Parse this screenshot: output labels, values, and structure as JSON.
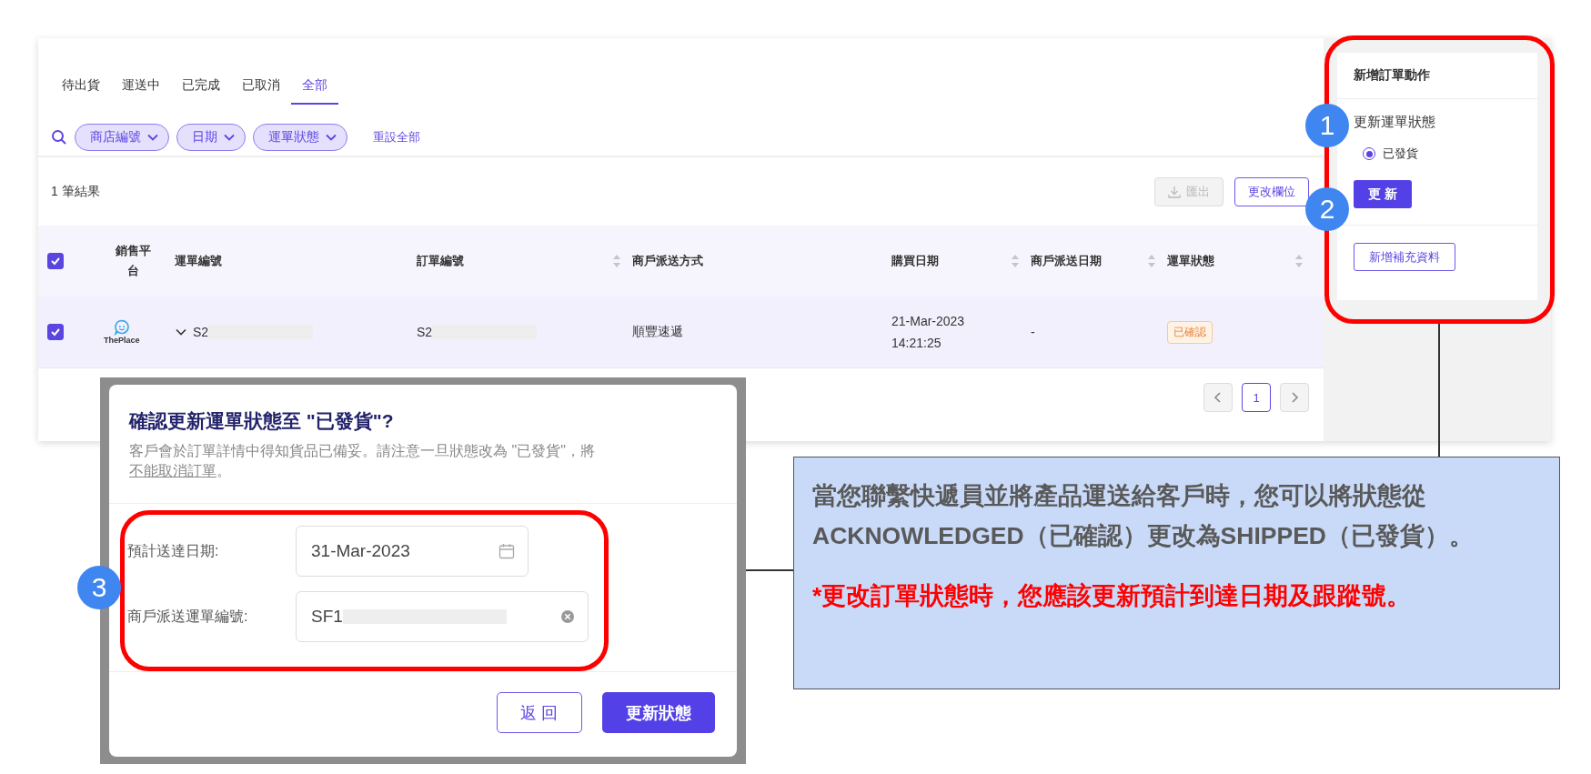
{
  "tabs": [
    {
      "label": "待出貨",
      "selected": false
    },
    {
      "label": "運送中",
      "selected": false
    },
    {
      "label": "已完成",
      "selected": false
    },
    {
      "label": "已取消",
      "selected": false
    },
    {
      "label": "全部",
      "selected": true
    }
  ],
  "filters": [
    {
      "label": "商店編號"
    },
    {
      "label": "日期"
    },
    {
      "label": "運單狀態"
    }
  ],
  "reset_link": "重設全部",
  "result_count": "1 筆結果",
  "toolbar": {
    "export": {
      "label": "匯出",
      "disabled": true
    },
    "columns_button": "更改欄位"
  },
  "table": {
    "header_checked": true,
    "columns": [
      {
        "label": "銷售平台",
        "sortable": false
      },
      {
        "label": "運單編號",
        "sortable": false
      },
      {
        "label": "訂單編號",
        "sortable": true
      },
      {
        "label": "商戶派送方式",
        "sortable": false
      },
      {
        "label": "購買日期",
        "sortable": true
      },
      {
        "label": "商戶派送日期",
        "sortable": true
      },
      {
        "label": "運單狀態",
        "sortable": true
      }
    ],
    "rows": [
      {
        "selected": true,
        "platform": "ThePlace",
        "shipment_no": "S2",
        "order_no": "S2",
        "delivery_method": "順豐速遞",
        "purchase_date": "21-Mar-2023",
        "purchase_time": "14:21:25",
        "delivery_date": "-",
        "status": "已確認"
      }
    ]
  },
  "pagination": {
    "pages": [
      {
        "label": "1",
        "selected": true
      }
    ]
  },
  "side_panel": {
    "title": "新增訂單動作",
    "section_title": "更新運單狀態",
    "options": [
      {
        "label": "已發貨",
        "selected": true
      }
    ],
    "update_button": "更 新",
    "add_info_button": "新增補充資料"
  },
  "dialog": {
    "title": "確認更新運單狀態至 \"已發貨\"?",
    "message": "客戶會於訂單詳情中得知貨品已備妥。請注意一旦狀態改為 \"已發貨\"，將",
    "message_link": "不能取消訂單",
    "message_end": "。",
    "fields": [
      {
        "kind": "date",
        "label": "預計送達日期:",
        "value": "31-Mar-2023"
      },
      {
        "kind": "text",
        "label": "商戶派送運單編號:",
        "value": "SF1"
      }
    ],
    "back_button": "返 回",
    "confirm_button": "更新狀態"
  },
  "annotations": {
    "markers": [
      "1",
      "2",
      "3"
    ],
    "callout": {
      "text": "當您聯繫快遞員並將產品運送給客戶時，您可以將狀態從ACKNOWLEDGED（已確認）更改為SHIPPED（已發貨）。",
      "note": "*更改訂單狀態時，您應該更新預計到達日期及跟蹤號。"
    }
  }
}
